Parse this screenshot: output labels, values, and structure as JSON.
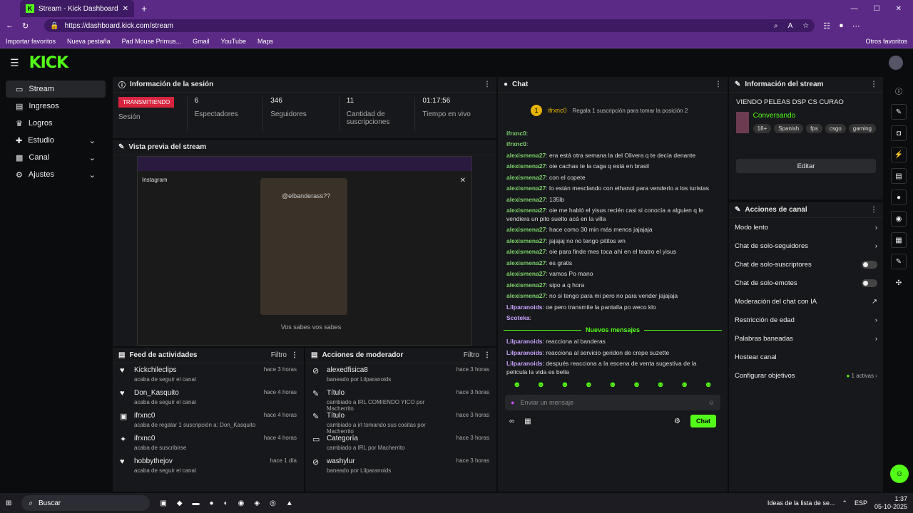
{
  "browser": {
    "tab_title": "Stream - Kick Dashboard",
    "url": "https://dashboard.kick.com/stream",
    "bookmarks": [
      "Importar favoritos",
      "Nueva pestaña",
      "Pad Mouse Primus...",
      "Gmail",
      "YouTube",
      "Maps"
    ],
    "other_favs": "Otros favoritos"
  },
  "brand": {
    "logo": "KICK",
    "accent": "#53fc18"
  },
  "sidebar": {
    "items": [
      {
        "label": "Stream",
        "icon": "stream-icon",
        "active": true
      },
      {
        "label": "Ingresos",
        "icon": "money-icon"
      },
      {
        "label": "Logros",
        "icon": "trophy-icon"
      },
      {
        "label": "Estudio",
        "icon": "studio-icon",
        "chevron": true
      },
      {
        "label": "Canal",
        "icon": "channel-icon",
        "chevron": true
      },
      {
        "label": "Ajustes",
        "icon": "gear-icon",
        "chevron": true
      }
    ]
  },
  "session": {
    "title": "Información de la sesión",
    "badge": "TRANSMITIENDO",
    "session_label": "Sesión",
    "stats": [
      {
        "value": "6",
        "label": "Espectadores"
      },
      {
        "value": "346",
        "label": "Seguidores"
      },
      {
        "value": "11",
        "label": "Cantidad de suscripciones"
      },
      {
        "value": "01:17:56",
        "label": "Tiempo en vivo"
      }
    ]
  },
  "preview": {
    "title": "Vista previa del stream",
    "caption": "Vos sabes vos sabes",
    "insta_label": "Instagram",
    "mention": "@elbanderass??"
  },
  "feed": {
    "title": "Feed de actividades",
    "filter": "Filtro",
    "items": [
      {
        "name": "Kickchileclips",
        "sub": "acaba de seguir el canal",
        "time": "hace 3 horas"
      },
      {
        "name": "Don_Kasquito",
        "sub": "acaba de seguir el canal",
        "time": "hace 4 horas"
      },
      {
        "name": "ifrxnc0",
        "sub": "acaba de regalar 1 suscripción a: Don_Kasquito",
        "time": "hace 4 horas"
      },
      {
        "name": "ifrxnc0",
        "sub": "acaba de suscribirse",
        "time": "hace 4 horas"
      },
      {
        "name": "hobbythejov",
        "sub": "acaba de seguir el canal",
        "time": "hace 1 día"
      }
    ]
  },
  "mod": {
    "title": "Acciones de moderador",
    "filter": "Filtro",
    "items": [
      {
        "name": "alexedfisica8",
        "sub": "baneado por Lilparanoids",
        "time": "hace 3 horas"
      },
      {
        "name": "Título",
        "sub": "cambiado a IRL COMIENDO YICO por Macherrito",
        "time": "hace 3 horas"
      },
      {
        "name": "Título",
        "sub": "cambiado a irl tomando sus cositas por Macherrito",
        "time": "hace 3 horas"
      },
      {
        "name": "Categoría",
        "sub": "cambiado a IRL por Macherrito",
        "time": "hace 3 horas"
      },
      {
        "name": "washylur",
        "sub": "baneado por Lilparanoids",
        "time": "hace 3 horas"
      }
    ]
  },
  "chat": {
    "title": "Chat",
    "pinned_user": "ifrxnc0",
    "pinned_text": "Regala 1 suscripción para tomar la posición 2",
    "messages": [
      {
        "user": "ifrxnc0",
        "text": ""
      },
      {
        "user": "ifrxnc0",
        "text": ""
      },
      {
        "user": "alexismena27",
        "text": "era está otra semana la del Olivera q te decía denante"
      },
      {
        "user": "alexismena27",
        "text": "oie cachas te la caga q está en brasil"
      },
      {
        "user": "alexismena27",
        "text": "con el copete"
      },
      {
        "user": "alexismena27",
        "text": "lo están mesclando con ethanol para venderlo a los turistas"
      },
      {
        "user": "alexismena27",
        "text": "135lb"
      },
      {
        "user": "alexismena27",
        "text": "oie me habló el yisus recién casi si conocía a alguien q le vendiera un pito suelto acá en la villa"
      },
      {
        "user": "alexismena27",
        "text": "hace como 30 min más menos jajajaja"
      },
      {
        "user": "alexismena27",
        "text": "jajajaj no no tengo pititos wn"
      },
      {
        "user": "alexismena27",
        "text": "oie para finde mes toca ahí en el teatro el yisus"
      },
      {
        "user": "alexismena27",
        "text": "es gratis"
      },
      {
        "user": "alexismena27",
        "text": "vamos Po mano"
      },
      {
        "user": "alexismena27",
        "text": "sipo a q hora"
      },
      {
        "user": "alexismena27",
        "text": "no si tengo para mi pero no para vender jajajaja"
      },
      {
        "user": "Lilparanoids",
        "text": "oe pero transmite la pantalla po weco klo"
      },
      {
        "user": "Scoteka",
        "text": ""
      }
    ],
    "new_label": "Nuevos mensajes",
    "new_messages": [
      {
        "user": "Lilparanoids",
        "text": "reacciona al banderas"
      },
      {
        "user": "Lilparanoids",
        "text": "reacciona al servicio geridon de crepe suzette"
      },
      {
        "user": "Lilparanoids",
        "text": "después reacciona a la escena de venta sugestiva de la película la vida es bella"
      }
    ],
    "input_placeholder": "Enviar un mensaje",
    "send": "Chat"
  },
  "stream_info": {
    "title": "Información del stream",
    "stream_title": "VIENDO PELEAS DSP CS CURAO",
    "category": "Conversando",
    "tags": [
      "18+",
      "Spanish",
      "fps",
      "csgo",
      "gaming"
    ],
    "edit": "Editar"
  },
  "channel_actions": {
    "title": "Acciones de canal",
    "items": [
      {
        "label": "Modo lento",
        "type": "chevron"
      },
      {
        "label": "Chat de solo-seguidores",
        "type": "chevron"
      },
      {
        "label": "Chat de solo-suscriptores",
        "type": "toggle"
      },
      {
        "label": "Chat de solo-emotes",
        "type": "toggle"
      },
      {
        "label": "Moderación del chat con IA",
        "type": "link"
      },
      {
        "label": "Restricción de edad",
        "type": "chevron"
      },
      {
        "label": "Palabras baneadas",
        "type": "chevron"
      },
      {
        "label": "Hostear canal",
        "type": "none"
      },
      {
        "label": "Configurar objetivos",
        "type": "chevron",
        "extra": "1 activas"
      }
    ]
  },
  "taskbar": {
    "search": "Buscar",
    "notif": "Ideas de la lista de se...",
    "lang": "ESP",
    "time": "1:37",
    "date": "05-10-2025"
  }
}
